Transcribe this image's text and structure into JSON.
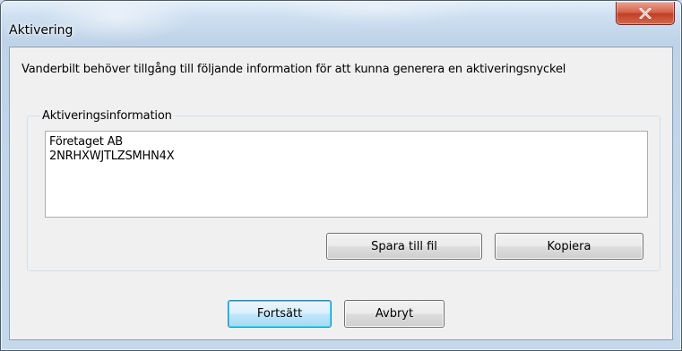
{
  "window": {
    "title": "Aktivering"
  },
  "description": "Vanderbilt behöver tillgång till följande information för att kunna generera en aktiveringsnyckel",
  "activation_group": {
    "label": "Aktiveringsinformation",
    "text_lines": [
      "Företaget AB",
      "2NRHXWJTLZSMHN4X"
    ],
    "save_label": "Spara till fil",
    "copy_label": "Kopiera"
  },
  "footer": {
    "continue_label": "Fortsätt",
    "cancel_label": "Avbryt"
  },
  "icons": {
    "close": "close-icon"
  },
  "colors": {
    "title_bar": "#c4d9ee",
    "close_button": "#c94a32",
    "client_background": "#f0f0f0",
    "default_button_border": "#3c7fb1"
  }
}
